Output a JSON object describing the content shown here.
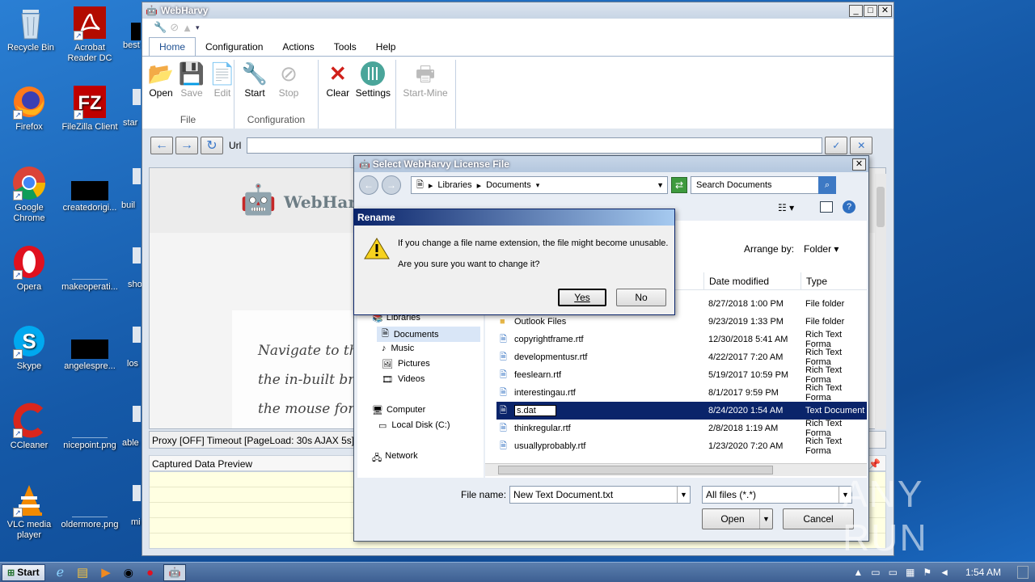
{
  "desktop": {
    "col1": [
      {
        "label": "Recycle Bin",
        "icon": "recycle-bin-icon"
      },
      {
        "label": "Firefox",
        "icon": "firefox-icon"
      },
      {
        "label": "Google Chrome",
        "icon": "chrome-icon"
      },
      {
        "label": "Opera",
        "icon": "opera-icon"
      },
      {
        "label": "Skype",
        "icon": "skype-icon"
      },
      {
        "label": "CCleaner",
        "icon": "ccleaner-icon"
      },
      {
        "label": "VLC media player",
        "icon": "vlc-icon"
      }
    ],
    "col2": [
      {
        "label": "Acrobat Reader DC",
        "icon": "acrobat-icon"
      },
      {
        "label": "FileZilla Client",
        "icon": "filezilla-icon"
      },
      {
        "label": "createdorigi...",
        "icon": "black-file-icon"
      },
      {
        "label": "makeoperati...",
        "icon": "blank-file-icon"
      },
      {
        "label": "angelespre...",
        "icon": "black-file-icon"
      },
      {
        "label": "nicepoint.png",
        "icon": "blank-file-icon"
      },
      {
        "label": "oldermore.png",
        "icon": "blank-file-icon"
      }
    ],
    "col3": [
      {
        "label": "best"
      },
      {
        "label": "star"
      },
      {
        "label": "buil"
      },
      {
        "label": "sho"
      },
      {
        "label": "los"
      },
      {
        "label": "able"
      },
      {
        "label": "mi"
      }
    ]
  },
  "webharvy": {
    "title": "WebHarvy",
    "tabs": [
      "Home",
      "Configuration",
      "Actions",
      "Tools",
      "Help"
    ],
    "groups": {
      "file": {
        "label": "File",
        "buttons": [
          "Open",
          "Save",
          "Edit"
        ]
      },
      "config": {
        "label": "Configuration",
        "buttons": [
          "Start",
          "Stop"
        ]
      },
      "misc": {
        "buttons": [
          "Clear",
          "Settings"
        ]
      },
      "mine": {
        "buttons": [
          "Start-Mine"
        ]
      }
    },
    "url_label": "Url",
    "brand": "WebHarv",
    "intro_lines": [
      "Navigate to th",
      "the in-built bro",
      "the mouse for c"
    ],
    "status": "Proxy [OFF] Timeout [PageLoad: 30s AJAX 5s] Mine",
    "preview_label": "Captured Data Preview"
  },
  "file_dialog": {
    "title": "Select WebHarvy License File",
    "breadcrumb": [
      "Libraries",
      "Documents"
    ],
    "search_placeholder": "Search Documents",
    "arrange_label": "Arrange by:",
    "arrange_value": "Folder",
    "col_date": "Date modified",
    "col_type": "Type",
    "nav": [
      {
        "label": "Libraries",
        "icon": "library-icon"
      },
      {
        "label": "Documents",
        "icon": "documents-icon"
      },
      {
        "label": "Music",
        "icon": "music-icon"
      },
      {
        "label": "Pictures",
        "icon": "pictures-icon"
      },
      {
        "label": "Videos",
        "icon": "videos-icon"
      },
      {
        "label": "Computer",
        "icon": "computer-icon"
      },
      {
        "label": "Local Disk (C:)",
        "icon": "disk-icon"
      },
      {
        "label": "Network",
        "icon": "network-icon"
      }
    ],
    "files": [
      {
        "name": "",
        "date": "8/27/2018 1:00 PM",
        "type": "File folder",
        "icon": "folder-icon"
      },
      {
        "name": "Outlook Files",
        "date": "9/23/2019 1:33 PM",
        "type": "File folder",
        "icon": "folder-icon"
      },
      {
        "name": "copyrightframe.rtf",
        "date": "12/30/2018 5:41 AM",
        "type": "Rich Text Forma",
        "icon": "rtf-icon"
      },
      {
        "name": "developmentusr.rtf",
        "date": "4/22/2017 7:20 AM",
        "type": "Rich Text Forma",
        "icon": "rtf-icon"
      },
      {
        "name": "feeslearn.rtf",
        "date": "5/19/2017 10:59 PM",
        "type": "Rich Text Forma",
        "icon": "rtf-icon"
      },
      {
        "name": "interestingau.rtf",
        "date": "8/1/2017 9:59 PM",
        "type": "Rich Text Forma",
        "icon": "rtf-icon"
      },
      {
        "name": "s.dat",
        "date": "8/24/2020 1:54 AM",
        "type": "Text Document",
        "icon": "txt-icon"
      },
      {
        "name": "thinkregular.rtf",
        "date": "2/8/2018 1:19 AM",
        "type": "Rich Text Forma",
        "icon": "rtf-icon"
      },
      {
        "name": "usuallyprobably.rtf",
        "date": "1/23/2020 7:20 AM",
        "type": "Rich Text Forma",
        "icon": "rtf-icon"
      }
    ],
    "filename_label": "File name:",
    "filename_value": "New Text Document.txt",
    "filter_value": "All files (*.*)",
    "open_label": "Open",
    "cancel_label": "Cancel"
  },
  "rename_dialog": {
    "title": "Rename",
    "line1": "If you change a file name extension, the file might become unusable.",
    "line2": "Are you sure you want to change it?",
    "yes": "Yes",
    "no": "No"
  },
  "taskbar": {
    "start": "Start",
    "time": "1:54 AM"
  },
  "watermark": "ANY RUN"
}
